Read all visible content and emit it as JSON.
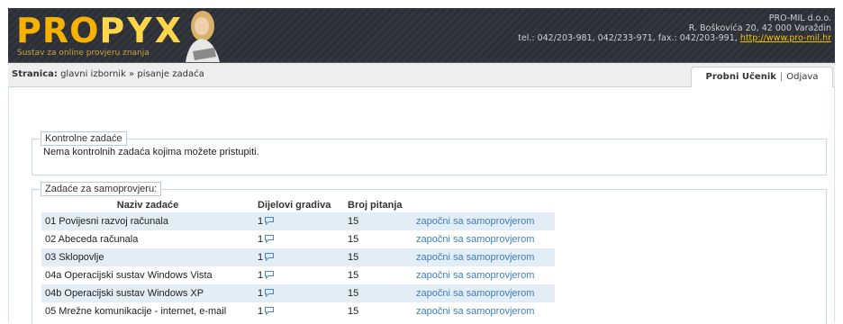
{
  "header": {
    "logo_part1": "PRO",
    "logo_part2": "PYX",
    "tagline": "Sustav za online provjeru znanja",
    "company_name": "PRO-MIL d.o.o.",
    "company_address": "R. Boškovića 20, 42 000 Varaždin",
    "company_contact": "tel.: 042/203-981, 042/233-971, fax.: 042/203-991, ",
    "company_url": "http://www.pro-mil.hr",
    "colors": {
      "logo_orange": "#f7b100",
      "background": "#2c2f35"
    }
  },
  "breadcrumb": {
    "prefix": "Stranica:",
    "path": "glavni izbornik » pisanje zadaća"
  },
  "user": {
    "name": "Probni Učenik",
    "separator": "|",
    "logout": "Odjava"
  },
  "kontrolne": {
    "legend": "Kontrolne zadaće",
    "message": "Nema kontrolnih zadaća kojima možete pristupiti."
  },
  "samoprovjera": {
    "legend": "Zadaće za samoprovjeru:",
    "columns": [
      "Naziv zadaće",
      "Dijelovi gradiva",
      "Broj pitanja",
      ""
    ],
    "rows": [
      {
        "name": "01 Povijesni razvoj računala",
        "parts": "1",
        "questions": "15",
        "action": "započni sa samoprovjerom"
      },
      {
        "name": "02 Abeceda računala",
        "parts": "1",
        "questions": "15",
        "action": "započni sa samoprovjerom"
      },
      {
        "name": "03 Sklopovlje",
        "parts": "1",
        "questions": "15",
        "action": "započni sa samoprovjerom"
      },
      {
        "name": "04a Operacijski sustav Windows Vista",
        "parts": "1",
        "questions": "15",
        "action": "započni sa samoprovjerom"
      },
      {
        "name": "04b Operacijski sustav Windows XP",
        "parts": "1",
        "questions": "15",
        "action": "započni sa samoprovjerom"
      },
      {
        "name": "05 Mrežne komunikacije - internet, e-mail",
        "parts": "1",
        "questions": "15",
        "action": "započni sa samoprovjerom"
      }
    ],
    "icons": {
      "parts": "comment-icon"
    },
    "colors": {
      "row_alt": "#e3edf6",
      "link": "#3a7fc0"
    }
  }
}
